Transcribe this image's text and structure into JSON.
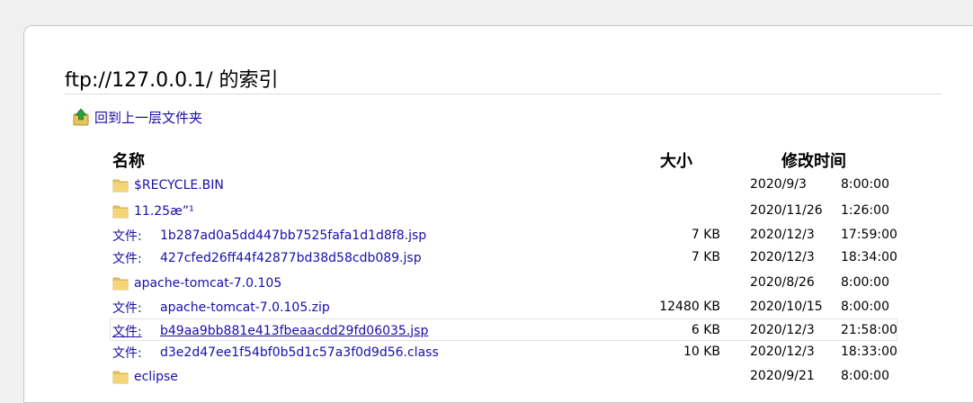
{
  "page": {
    "title": "ftp://127.0.0.1/ 的索引",
    "parent_link": "回到上一层文件夹",
    "file_prefix": "文件:"
  },
  "headers": {
    "name": "名称",
    "size": "大小",
    "modified": "修改时间"
  },
  "colors": {
    "link": "#1a0dab",
    "folder": "#e8c25a",
    "up_arrow": "#2e9e3a"
  },
  "entries": [
    {
      "type": "folder",
      "name": "$RECYCLE.BIN",
      "size": "",
      "date": "2020/9/3",
      "time": "8:00:00"
    },
    {
      "type": "folder",
      "name": "11.25æ”¹",
      "size": "",
      "date": "2020/11/26",
      "time": "1:26:00"
    },
    {
      "type": "file",
      "name": "1b287ad0a5dd447bb7525fafa1d1d8f8.jsp",
      "size": "7 KB",
      "date": "2020/12/3",
      "time": "17:59:00"
    },
    {
      "type": "file",
      "name": "427cfed26ff44f42877bd38d58cdb089.jsp",
      "size": "7 KB",
      "date": "2020/12/3",
      "time": "18:34:00"
    },
    {
      "type": "folder",
      "name": "apache-tomcat-7.0.105",
      "size": "",
      "date": "2020/8/26",
      "time": "8:00:00"
    },
    {
      "type": "file",
      "name": "apache-tomcat-7.0.105.zip",
      "size": "12480 KB",
      "date": "2020/10/15",
      "time": "8:00:00"
    },
    {
      "type": "file",
      "name": "b49aa9bb881e413fbeaacdd29fd06035.jsp",
      "size": "6 KB",
      "date": "2020/12/3",
      "time": "21:58:00",
      "hover": true
    },
    {
      "type": "file",
      "name": "d3e2d47ee1f54bf0b5d1c57a3f0d9d56.class",
      "size": "10 KB",
      "date": "2020/12/3",
      "time": "18:33:00"
    },
    {
      "type": "folder",
      "name": "eclipse",
      "size": "",
      "date": "2020/9/21",
      "time": "8:00:00"
    }
  ]
}
